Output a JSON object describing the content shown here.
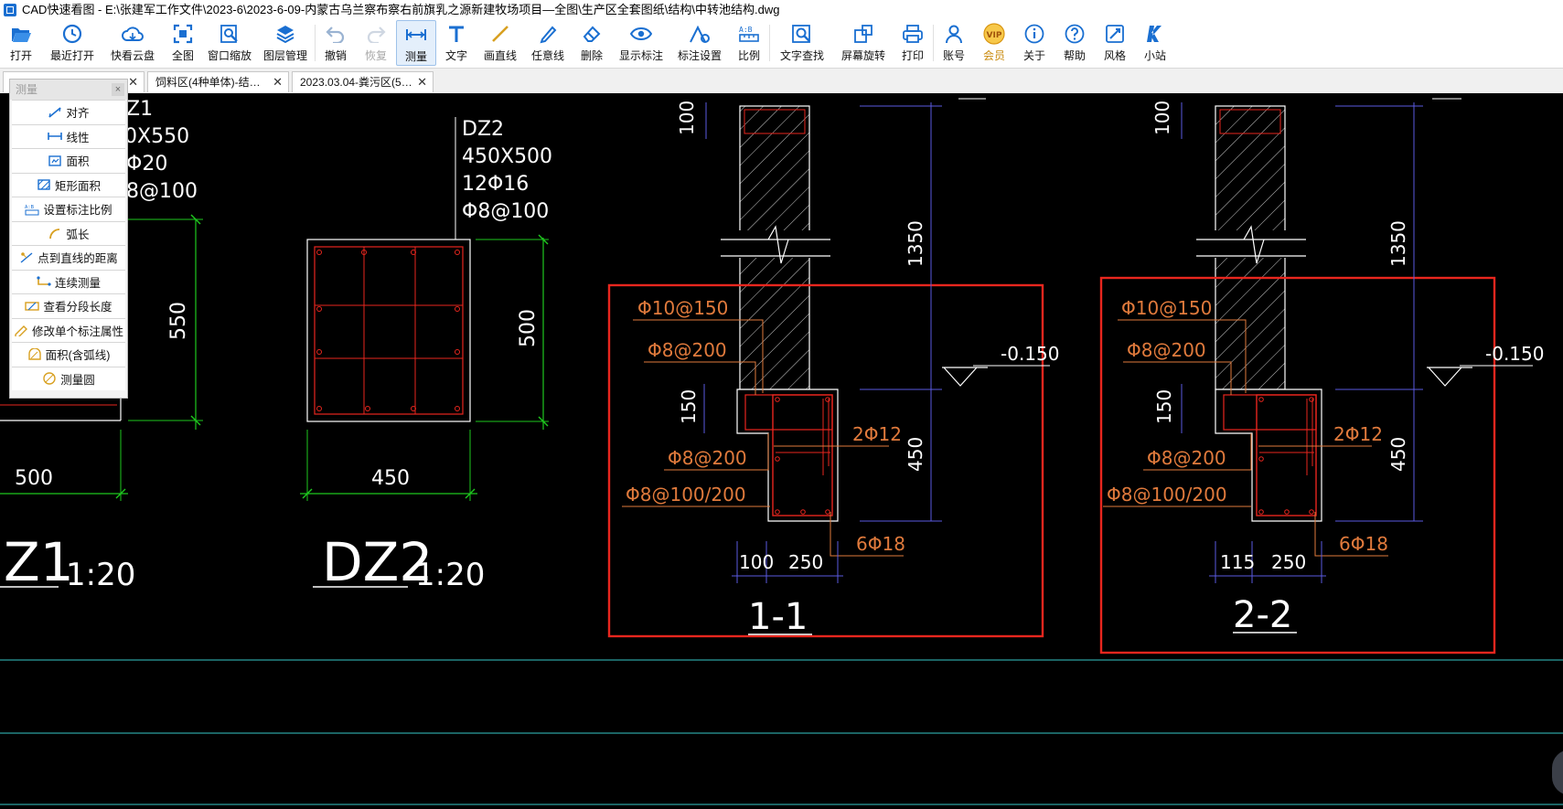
{
  "window": {
    "title": "CAD快速看图 - E:\\张建军工作文件\\2023-6\\2023-6-09-内蒙古乌兰察布察右前旗乳之源新建牧场项目—全图\\生产区全套图纸\\结构\\中转池结构.dwg"
  },
  "toolbar": {
    "items": [
      {
        "label": "打开",
        "icon": "folder-open-icon"
      },
      {
        "label": "最近打开",
        "icon": "clock-icon"
      },
      {
        "label": "快看云盘",
        "icon": "cloud-icon"
      },
      {
        "label": "全图",
        "icon": "fit-all-icon"
      },
      {
        "label": "窗口缩放",
        "icon": "zoom-window-icon"
      },
      {
        "label": "图层管理",
        "icon": "layers-icon"
      },
      {
        "label": "撤销",
        "icon": "undo-icon"
      },
      {
        "label": "恢复",
        "icon": "redo-icon"
      },
      {
        "label": "测量",
        "icon": "measure-icon"
      },
      {
        "label": "文字",
        "icon": "text-icon"
      },
      {
        "label": "画直线",
        "icon": "line-icon"
      },
      {
        "label": "任意线",
        "icon": "pen-icon"
      },
      {
        "label": "删除",
        "icon": "eraser-icon"
      },
      {
        "label": "显示标注",
        "icon": "eye-icon"
      },
      {
        "label": "标注设置",
        "icon": "annotation-settings-icon"
      },
      {
        "label": "比例",
        "icon": "scale-icon"
      },
      {
        "label": "文字查找",
        "icon": "text-search-icon"
      },
      {
        "label": "屏幕旋转",
        "icon": "rotate-screen-icon"
      },
      {
        "label": "打印",
        "icon": "printer-icon"
      },
      {
        "label": "账号",
        "icon": "user-icon"
      },
      {
        "label": "会员",
        "icon": "vip-icon"
      },
      {
        "label": "关于",
        "icon": "info-icon"
      },
      {
        "label": "帮助",
        "icon": "help-icon"
      },
      {
        "label": "风格",
        "icon": "style-icon"
      },
      {
        "label": "小站",
        "icon": "k-logo-icon"
      }
    ]
  },
  "tabs": [
    {
      "label": ""
    },
    {
      "label": "饲料区(4种单体)-结…"
    },
    {
      "label": "2023.03.04-粪污区(5…"
    }
  ],
  "measure_panel": {
    "title": "测量",
    "items": [
      "对齐",
      "线性",
      "面积",
      "矩形面积",
      "设置标注比例",
      "弧长",
      "点到直线的距离",
      "连续测量",
      "查看分段长度",
      "修改单个标注属性",
      "面积(含弧线)",
      "测量圆"
    ]
  },
  "drawing": {
    "dz1": {
      "title_partial": "Z1",
      "scale": "1:20",
      "spec_lines": [
        "Z1",
        "0X550",
        "Φ20",
        "8@100"
      ],
      "dim_height": "550",
      "dim_width": "500"
    },
    "dz2": {
      "title": "DZ2",
      "scale": "1:20",
      "spec_lines": [
        "DZ2",
        "450X500",
        "12Φ16",
        "Φ8@100"
      ],
      "dim_height": "500",
      "dim_width": "450"
    },
    "section_1": {
      "title": "1-1",
      "labels": {
        "top_stirrup": "Φ10@150",
        "mid_stirrup": "Φ8@200",
        "tie_rebar": "2Φ12",
        "lower_stirrup": "Φ8@200",
        "base_stirrup": "Φ8@100/200",
        "bottom_rebar": "6Φ18",
        "elevation": "-0.150"
      },
      "dims": {
        "top": "100",
        "h1350": "1350",
        "h150": "150",
        "h450": "450",
        "w100": "100",
        "w250": "250"
      }
    },
    "section_2": {
      "title": "2-2",
      "labels": {
        "top_stirrup": "Φ10@150",
        "mid_stirrup": "Φ8@200",
        "tie_rebar": "2Φ12",
        "lower_stirrup": "Φ8@200",
        "base_stirrup": "Φ8@100/200",
        "bottom_rebar": "6Φ18",
        "elevation": "-0.150"
      },
      "dims": {
        "top": "100",
        "h1350": "1350",
        "h150": "150",
        "h450": "450",
        "w115": "115",
        "w250": "250"
      }
    }
  },
  "colors": {
    "canvas_bg": "#000000",
    "cad_white": "#ffffff",
    "cad_red": "#e8261e",
    "cad_green": "#1ec81e",
    "cad_blue": "#5a5ae0",
    "cad_orange": "#e07a3c",
    "cad_cyan": "#36c9c9",
    "tool_blue": "#1a6fd1"
  }
}
